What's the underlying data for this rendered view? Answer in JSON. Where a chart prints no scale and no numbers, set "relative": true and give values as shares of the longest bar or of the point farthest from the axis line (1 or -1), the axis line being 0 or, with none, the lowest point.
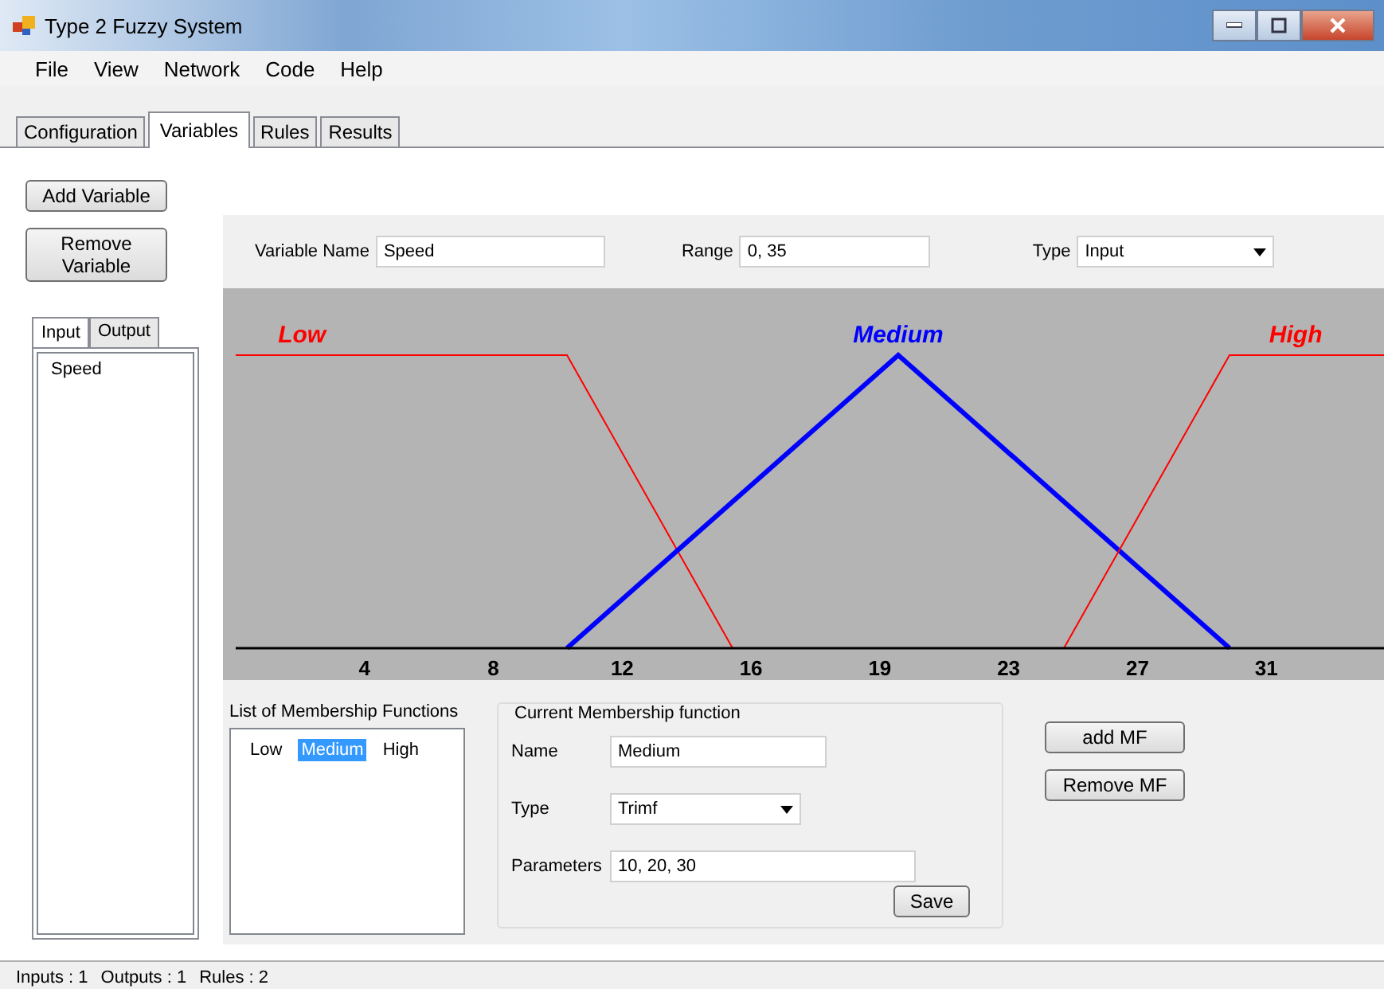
{
  "window": {
    "title": "Type 2 Fuzzy System"
  },
  "menu": [
    "File",
    "View",
    "Network",
    "Code",
    "Help"
  ],
  "tabs": [
    {
      "label": "Configuration",
      "selected": false
    },
    {
      "label": "Variables",
      "selected": true
    },
    {
      "label": "Rules",
      "selected": false
    },
    {
      "label": "Results",
      "selected": false
    }
  ],
  "variable_buttons": [
    "Add Variable",
    "Remove Variable"
  ],
  "variable_tabs": [
    {
      "label": "Input",
      "selected": true
    },
    {
      "label": "Output",
      "selected": false
    }
  ],
  "variables": [
    {
      "name": "Speed",
      "selected": false
    }
  ],
  "variable_form": {
    "name_label": "Variable Name",
    "name": "Speed",
    "range_label": "Range",
    "range": "0, 35",
    "type_label": "Type",
    "type": "Input"
  },
  "chart_data": {
    "type": "line",
    "x": [
      0,
      10,
      15,
      20,
      25,
      30,
      35
    ],
    "xlim": [
      0,
      35
    ],
    "relative": true,
    "xticks": [
      {
        "value": 3.889,
        "label": "4"
      },
      {
        "value": 7.778,
        "label": "8"
      },
      {
        "value": 11.667,
        "label": "12"
      },
      {
        "value": 15.556,
        "label": "16"
      },
      {
        "value": 19.444,
        "label": "19"
      },
      {
        "value": 23.333,
        "label": "23"
      },
      {
        "value": 27.222,
        "label": "27"
      },
      {
        "value": 31.111,
        "label": "31"
      }
    ],
    "series": [
      {
        "name": "Low",
        "color": "#ff0000",
        "values": [
          1,
          1,
          0,
          null,
          null,
          null,
          null
        ]
      },
      {
        "name": "Medium",
        "color": "#0000ff",
        "values": [
          null,
          0,
          0.5,
          1,
          0.5,
          0,
          null
        ]
      },
      {
        "name": "High",
        "color": "#ff0000",
        "values": [
          null,
          null,
          null,
          null,
          0,
          1,
          1
        ]
      }
    ]
  },
  "mf_list": {
    "title": "List of Membership Functions",
    "items": [
      {
        "label": "Low",
        "selected": false
      },
      {
        "label": "Medium",
        "selected": true
      },
      {
        "label": "High",
        "selected": false
      }
    ]
  },
  "current_mf": {
    "title": "Current Membership function",
    "name_label": "Name",
    "name": "Medium",
    "type_label": "Type",
    "type": "Trimf",
    "parameters_label": "Parameters",
    "parameters": "10, 20, 30",
    "save": "Save"
  },
  "mf_buttons": [
    "add MF",
    "Remove MF"
  ],
  "status_bar": [
    "Inputs : 1",
    "Outputs : 1",
    "Rules : 2"
  ]
}
